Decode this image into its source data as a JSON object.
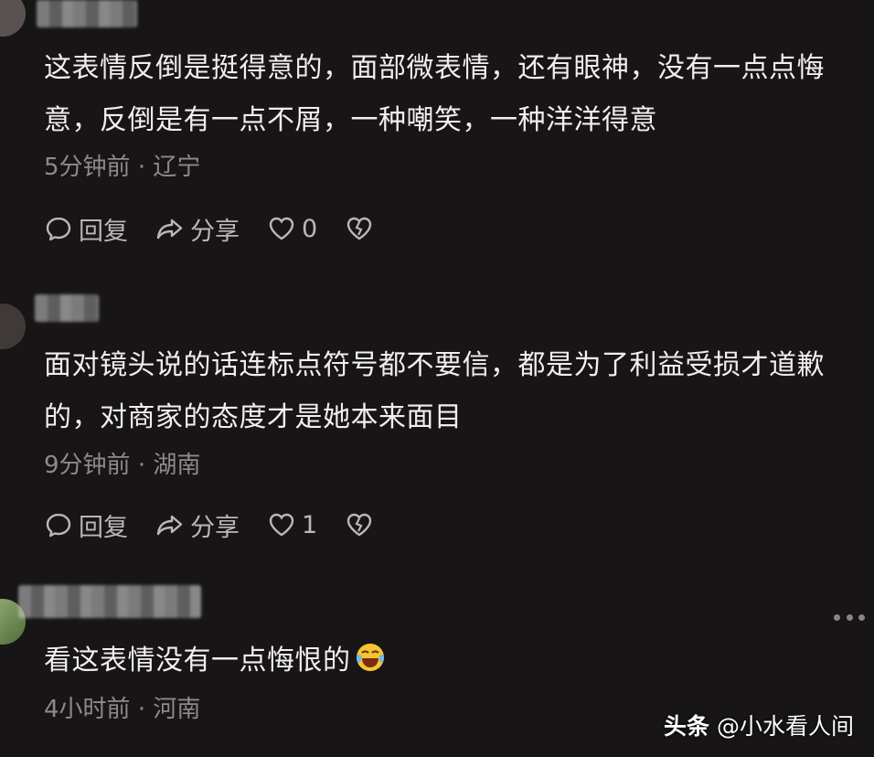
{
  "comments": [
    {
      "text": "这表情反倒是挺得意的，面部微表情，还有眼神，没有一点点悔意，反倒是有一点不屑，一种嘲笑，一种洋洋得意",
      "time": "5分钟前",
      "location": "辽宁",
      "reply_label": "回复",
      "share_label": "分享",
      "likes": "0"
    },
    {
      "text": "面对镜头说的话连标点符号都不要信，都是为了利益受损才道歉的，对商家的态度才是她本来面目",
      "time": "9分钟前",
      "location": "湖南",
      "reply_label": "回复",
      "share_label": "分享",
      "likes": "1"
    },
    {
      "text": "看这表情没有一点悔恨的",
      "time": "4小时前",
      "location": "河南"
    }
  ],
  "meta_separator": "·",
  "watermark": {
    "platform": "头条",
    "handle": "@小水看人间"
  },
  "colors": {
    "background": "#181516",
    "text": "#f1eeef",
    "meta": "#8f898b",
    "action": "#bcb6b8"
  },
  "icons": [
    "comment-icon",
    "share-icon",
    "heart-icon",
    "broken-heart-icon",
    "more-icon",
    "laughing-crying-emoji"
  ]
}
